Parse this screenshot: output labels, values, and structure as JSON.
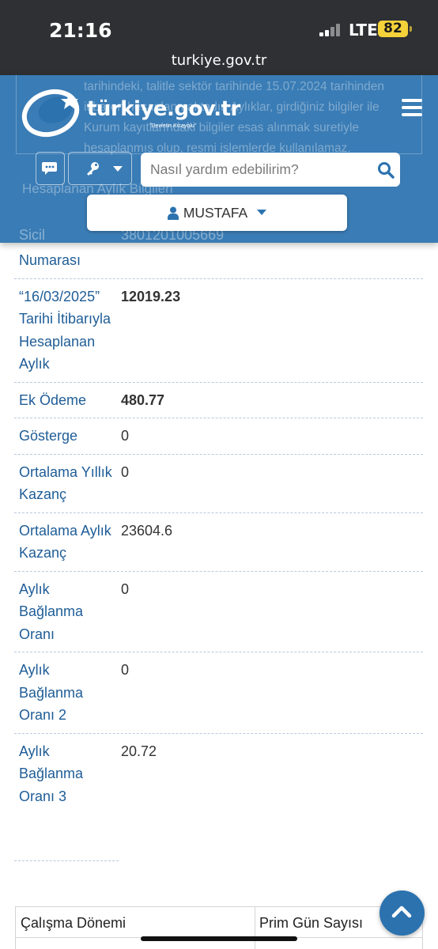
{
  "status_bar": {
    "time": "21:16",
    "network": "LTE",
    "battery": "82"
  },
  "browser": {
    "url": "turkiye.gov.tr"
  },
  "background_partial": {
    "notice_text": "tarihindeki, talitle sektör tarihinde 15.07.2024 tarihinden itibaren hesaplanmaktadır. Aylıklar, girdiğiniz bilgiler ile Kurum kayıtlarındaki bilgiler esas alınmak suretiyle hesaplanmış olup, resmi işlemlerde kullanılamaz.",
    "section_heading": "Hesaplanan Aylık Bilgileri",
    "sicil_label": "Sicil",
    "sicil_value": "3801201005669"
  },
  "header": {
    "logo_text": "türkiye.gov.tr",
    "logo_slogan": "\"Devletin Kısayolu\"",
    "search_placeholder": "Nasıl yardım edebilirim?",
    "user_name": "MUSTAFA"
  },
  "info_rows": [
    {
      "label": "Numarası",
      "value": ""
    },
    {
      "label": "“16/03/2025” Tarihi İtibarıyla Hesaplanan Aylık",
      "value": "12019.23"
    },
    {
      "label": "Ek Ödeme",
      "value": "480.77"
    },
    {
      "label": "Gösterge",
      "value": "0"
    },
    {
      "label": "Ortalama Yıllık Kazanç",
      "value": "0"
    },
    {
      "label": "Ortalama Aylık Kazanç",
      "value": "23604.6"
    },
    {
      "label": "Aylık Bağlanma Oranı",
      "value": "0"
    },
    {
      "label": "Aylık Bağlanma Oranı 2",
      "value": "0"
    },
    {
      "label": "Aylık Bağlanma Oranı 3",
      "value": "20.72"
    }
  ],
  "bottom_table": {
    "col1": "Çalışma Dönemi",
    "col2": "Prim Gün Sayısı"
  },
  "colors": {
    "header_blue": "#2b72af",
    "label_blue": "#1f5d97",
    "status_bar": "#2e3033"
  }
}
